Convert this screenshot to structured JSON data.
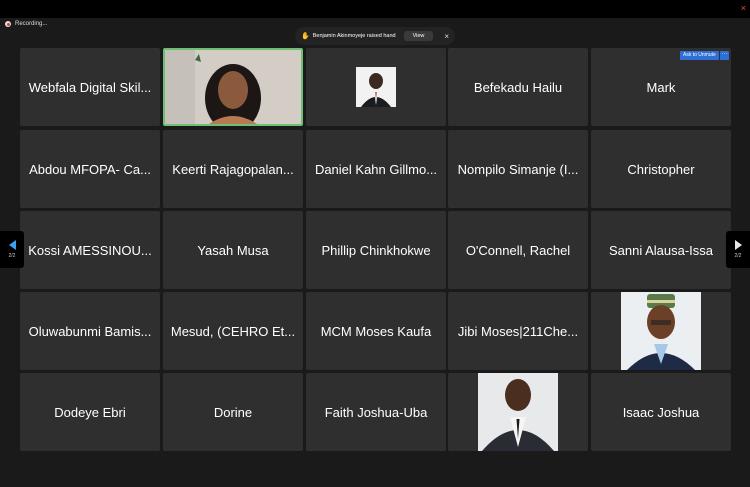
{
  "window": {
    "close_glyph": "×"
  },
  "recording": {
    "label": "Recording..."
  },
  "notification": {
    "text": "Benjamin Akinmoyeje raised hand",
    "view_label": "View",
    "close_glyph": "×",
    "hand_glyph": "✋"
  },
  "active_tile_controls": {
    "ask_unmute_label": "Ask to Unmute",
    "more_glyph": "···"
  },
  "participants": [
    "Webfala Digital Skil...",
    "",
    "",
    "Befekadu Hailu",
    "Mark",
    "Abdou MFOPA- Ca...",
    "Keerti Rajagopalan...",
    "Daniel Kahn Gillmo...",
    "Nompilo Simanje (I...",
    "Christopher",
    "Kossi AMESSINOU...",
    "Yasah Musa",
    "Phillip Chinkhokwe",
    "O'Connell, Rachel",
    "Sanni Alausa-Issa",
    "Oluwabunmi Bamis...",
    "Mesud, (CEHRO Et...",
    "MCM Moses Kaufa",
    "Jibi Moses|211Che...",
    "",
    "Dodeye Ebri",
    "Dorine",
    "Faith Joshua-Uba",
    "",
    "Isaac Joshua"
  ],
  "pagination": {
    "left": "2/2",
    "right": "2/2"
  },
  "colors": {
    "active_border": "#6fbf73",
    "accent": "#2d6fd6",
    "tile_bg": "#2f2f2f"
  }
}
